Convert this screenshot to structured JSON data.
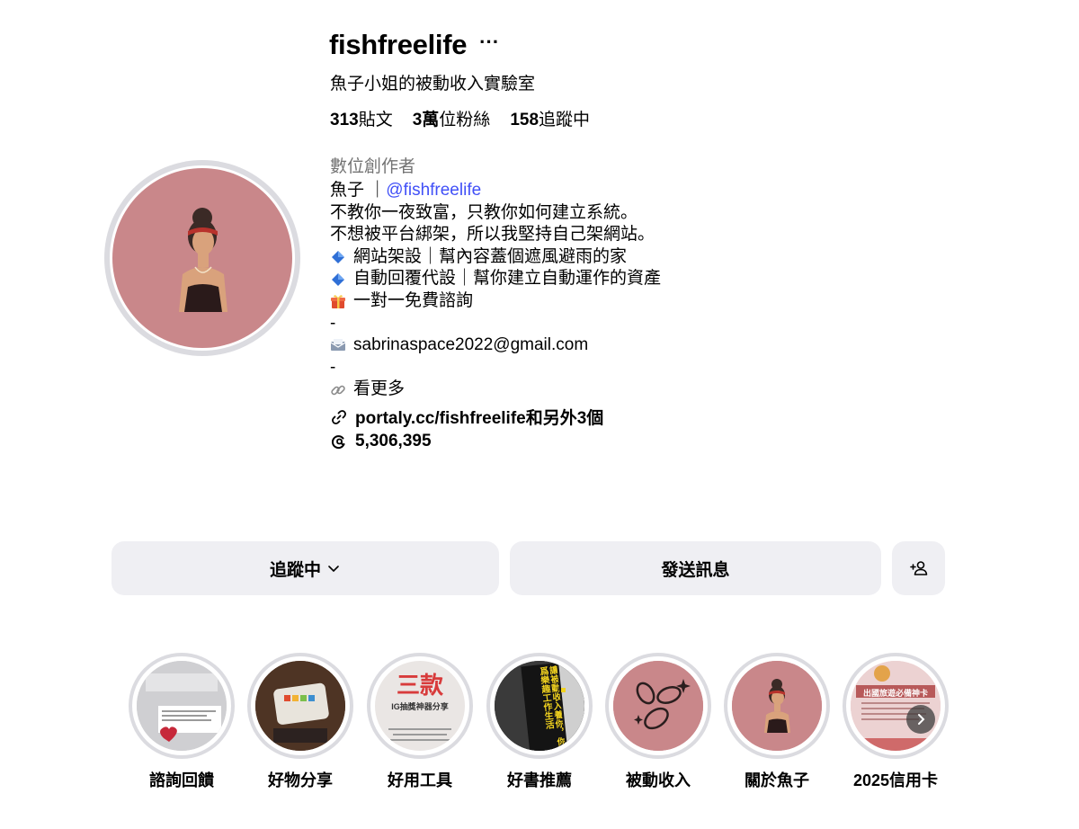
{
  "profile": {
    "username": "fishfreelife",
    "more_label": "···",
    "full_name": "魚子小姐的被動收入實驗室",
    "stats": {
      "posts_count": "313",
      "posts_label": "貼文",
      "followers_count": "3萬",
      "followers_label": "位粉絲",
      "following_count": "158",
      "following_label": "追蹤中"
    },
    "category": "數位創作者",
    "bio": {
      "line1_prefix": "魚子 ｜",
      "line1_mention": "@fishfreelife",
      "line2": "不教你一夜致富，只教你如何建立系統。",
      "line3": "不想被平台綁架，所以我堅持自己架網站。",
      "line4": "網站架設｜幫內容蓋個遮風避雨的家",
      "line5": "自動回覆代設｜幫你建立自動運作的資產",
      "line6": "一對一免費諮詢",
      "line7": "-",
      "line8": "sabrinaspace2022@gmail.com",
      "line9": "-",
      "line10": "看更多"
    },
    "link": "portaly.cc/fishfreelife和另外3個",
    "threads_count": "5,306,395"
  },
  "actions": {
    "following_label": "追蹤中",
    "message_label": "發送訊息"
  },
  "highlights": [
    {
      "label": "諮詢回饋",
      "icon": "feedback-cover"
    },
    {
      "label": "好物分享",
      "icon": "product-cover"
    },
    {
      "label": "好用工具",
      "icon": "tools-cover",
      "cover_title": "三款",
      "cover_sub": "IG抽獎神器分享"
    },
    {
      "label": "好書推薦",
      "icon": "book-cover",
      "cover_text": "讓被動收入養你，你爲樂趣工作生活"
    },
    {
      "label": "被動收入",
      "icon": "coins-cover"
    },
    {
      "label": "關於魚子",
      "icon": "avatar-cover"
    },
    {
      "label": "2025信用卡",
      "icon": "card-cover",
      "cover_title": "出國旅遊必備神卡"
    }
  ],
  "colors": {
    "avatar_bg": "#c9878a",
    "mention": "#4150f7",
    "button_bg": "#efeff3",
    "category": "#737373"
  }
}
